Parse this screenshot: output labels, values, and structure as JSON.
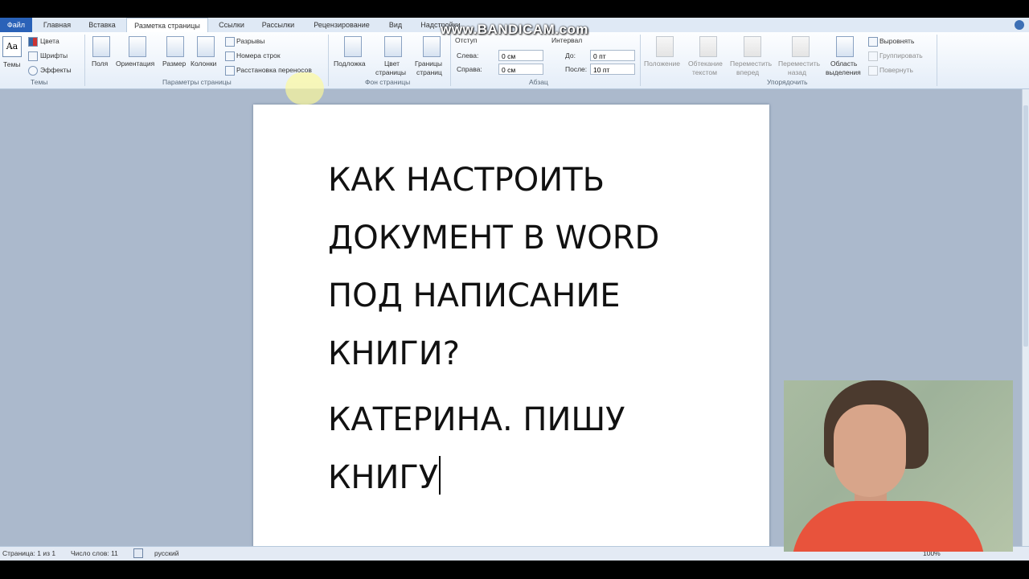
{
  "watermark": "www.BANDICAM.com",
  "tabs": [
    {
      "label": "Файл"
    },
    {
      "label": "Главная"
    },
    {
      "label": "Вставка"
    },
    {
      "label": "Разметка страницы"
    },
    {
      "label": "Ссылки"
    },
    {
      "label": "Рассылки"
    },
    {
      "label": "Рецензирование"
    },
    {
      "label": "Вид"
    },
    {
      "label": "Надстройки"
    }
  ],
  "ribbon": {
    "themes": {
      "themes_label": "Темы",
      "colors": "Цвета",
      "fonts": "Шрифты",
      "effects": "Эффекты",
      "group": "Темы"
    },
    "page_setup": {
      "margins": "Поля",
      "orientation": "Ориентация",
      "size": "Размер",
      "columns": "Колонки",
      "breaks": "Разрывы",
      "line_numbers": "Номера строк",
      "hyphenation": "Расстановка переносов",
      "group": "Параметры страницы"
    },
    "page_background": {
      "watermark": "Подложка",
      "page_color_1": "Цвет",
      "page_color_2": "страницы",
      "page_borders_1": "Границы",
      "page_borders_2": "страниц",
      "group": "Фон страницы"
    },
    "paragraph": {
      "indent_title": "Отступ",
      "indent_left_label": "Слева:",
      "indent_left_value": "0 см",
      "indent_right_label": "Справа:",
      "indent_right_value": "0 см",
      "spacing_title": "Интервал",
      "spacing_before_label": "До:",
      "spacing_before_value": "0 пт",
      "spacing_after_label": "После:",
      "spacing_after_value": "10 пт",
      "group": "Абзац"
    },
    "arrange": {
      "position_1": "Положение",
      "wrap_1": "Обтекание",
      "wrap_2": "текстом",
      "forward_1": "Переместить",
      "forward_2": "вперед",
      "backward_1": "Переместить",
      "backward_2": "назад",
      "selection_1": "Область",
      "selection_2": "выделения",
      "align": "Выровнять",
      "group_btn": "Группировать",
      "rotate": "Повернуть",
      "group": "Упорядочить"
    }
  },
  "document": {
    "lines": [
      "КАК НАСТРОИТЬ",
      "ДОКУМЕНТ В WORD",
      "ПОД НАПИСАНИЕ",
      "КНИГИ?",
      "КАТЕРИНА. ПИШУ",
      "КНИГУ"
    ]
  },
  "status": {
    "page": "Страница: 1 из 1",
    "words": "Число слов: 11",
    "language": "русский",
    "zoom": "100%"
  }
}
